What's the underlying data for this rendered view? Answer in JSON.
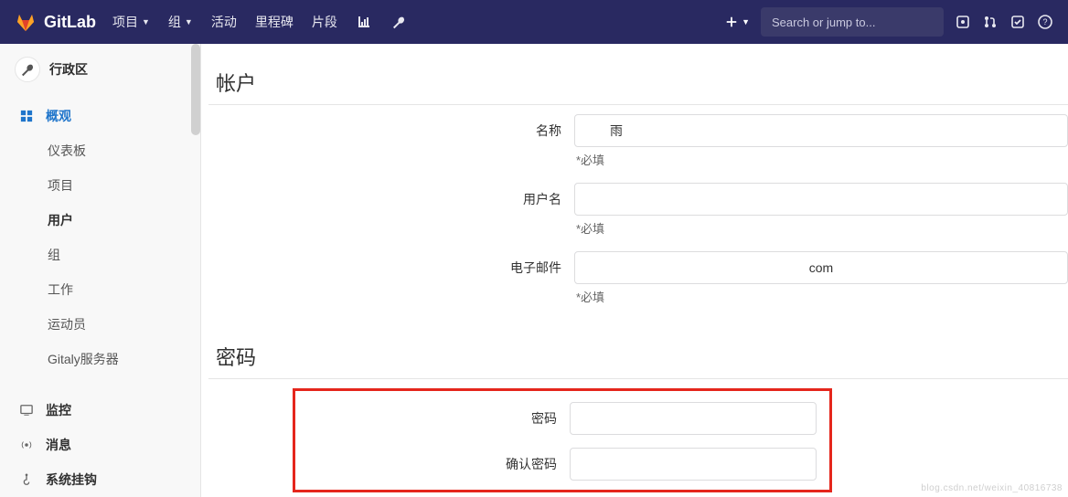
{
  "brand": {
    "name": "GitLab"
  },
  "top_nav": {
    "items": [
      "项目",
      "组",
      "活动",
      "里程碑",
      "片段"
    ],
    "search_placeholder": "Search or jump to..."
  },
  "sidebar": {
    "context": "行政区",
    "overview": {
      "label": "概观",
      "sub": [
        "仪表板",
        "项目",
        "用户",
        "组",
        "工作",
        "运动员",
        "Gitaly服务器"
      ],
      "active_index": 2
    },
    "bottom": {
      "monitoring": "监控",
      "messages": "消息",
      "hooks": "系统挂钩"
    }
  },
  "main": {
    "account": {
      "title": "帐户",
      "name_label": "名称",
      "name_value": "雨",
      "required": "*必填",
      "username_label": "用户名",
      "username_value": "",
      "email_label": "电子邮件",
      "email_value": "com"
    },
    "password": {
      "title": "密码",
      "password_label": "密码",
      "confirm_label": "确认密码"
    }
  },
  "watermark": "blog.csdn.net/weixin_40816738"
}
